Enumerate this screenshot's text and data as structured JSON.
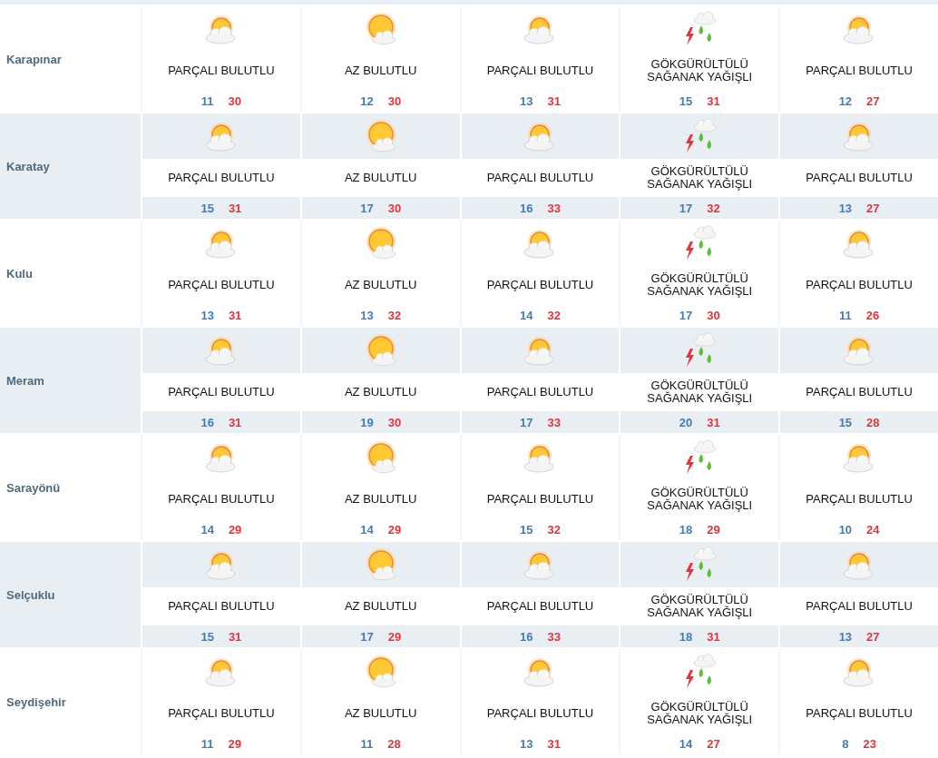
{
  "districts": [
    {
      "name": "Karapınar",
      "days": [
        {
          "kind": "partly-cloudy",
          "condition": "PARÇALI BULUTLU",
          "low": "11",
          "high": "30"
        },
        {
          "kind": "few-clouds",
          "condition": "AZ BULUTLU",
          "low": "12",
          "high": "30"
        },
        {
          "kind": "partly-cloudy",
          "condition": "PARÇALI BULUTLU",
          "low": "13",
          "high": "31"
        },
        {
          "kind": "thunderstorm",
          "condition": "GÖKGÜRÜLTÜLÜ SAĞANAK YAĞIŞLI",
          "low": "15",
          "high": "31"
        },
        {
          "kind": "partly-cloudy",
          "condition": "PARÇALI BULUTLU",
          "low": "12",
          "high": "27"
        }
      ]
    },
    {
      "name": "Karatay",
      "days": [
        {
          "kind": "partly-cloudy",
          "condition": "PARÇALI BULUTLU",
          "low": "15",
          "high": "31"
        },
        {
          "kind": "few-clouds",
          "condition": "AZ BULUTLU",
          "low": "17",
          "high": "30"
        },
        {
          "kind": "partly-cloudy",
          "condition": "PARÇALI BULUTLU",
          "low": "16",
          "high": "33"
        },
        {
          "kind": "thunderstorm",
          "condition": "GÖKGÜRÜLTÜLÜ SAĞANAK YAĞIŞLI",
          "low": "17",
          "high": "32"
        },
        {
          "kind": "partly-cloudy",
          "condition": "PARÇALI BULUTLU",
          "low": "13",
          "high": "27"
        }
      ]
    },
    {
      "name": "Kulu",
      "days": [
        {
          "kind": "partly-cloudy",
          "condition": "PARÇALI BULUTLU",
          "low": "13",
          "high": "31"
        },
        {
          "kind": "few-clouds",
          "condition": "AZ BULUTLU",
          "low": "13",
          "high": "32"
        },
        {
          "kind": "partly-cloudy",
          "condition": "PARÇALI BULUTLU",
          "low": "14",
          "high": "32"
        },
        {
          "kind": "thunderstorm",
          "condition": "GÖKGÜRÜLTÜLÜ SAĞANAK YAĞIŞLI",
          "low": "17",
          "high": "30"
        },
        {
          "kind": "partly-cloudy",
          "condition": "PARÇALI BULUTLU",
          "low": "11",
          "high": "26"
        }
      ]
    },
    {
      "name": "Meram",
      "days": [
        {
          "kind": "partly-cloudy",
          "condition": "PARÇALI BULUTLU",
          "low": "16",
          "high": "31"
        },
        {
          "kind": "few-clouds",
          "condition": "AZ BULUTLU",
          "low": "19",
          "high": "30"
        },
        {
          "kind": "partly-cloudy",
          "condition": "PARÇALI BULUTLU",
          "low": "17",
          "high": "33"
        },
        {
          "kind": "thunderstorm",
          "condition": "GÖKGÜRÜLTÜLÜ SAĞANAK YAĞIŞLI",
          "low": "20",
          "high": "31"
        },
        {
          "kind": "partly-cloudy",
          "condition": "PARÇALI BULUTLU",
          "low": "15",
          "high": "28"
        }
      ]
    },
    {
      "name": "Sarayönü",
      "days": [
        {
          "kind": "partly-cloudy",
          "condition": "PARÇALI BULUTLU",
          "low": "14",
          "high": "29"
        },
        {
          "kind": "few-clouds",
          "condition": "AZ BULUTLU",
          "low": "14",
          "high": "29"
        },
        {
          "kind": "partly-cloudy",
          "condition": "PARÇALI BULUTLU",
          "low": "15",
          "high": "32"
        },
        {
          "kind": "thunderstorm",
          "condition": "GÖKGÜRÜLTÜLÜ SAĞANAK YAĞIŞLI",
          "low": "18",
          "high": "29"
        },
        {
          "kind": "partly-cloudy",
          "condition": "PARÇALI BULUTLU",
          "low": "10",
          "high": "24"
        }
      ]
    },
    {
      "name": "Selçuklu",
      "days": [
        {
          "kind": "partly-cloudy",
          "condition": "PARÇALI BULUTLU",
          "low": "15",
          "high": "31"
        },
        {
          "kind": "few-clouds",
          "condition": "AZ BULUTLU",
          "low": "17",
          "high": "29"
        },
        {
          "kind": "partly-cloudy",
          "condition": "PARÇALI BULUTLU",
          "low": "16",
          "high": "33"
        },
        {
          "kind": "thunderstorm",
          "condition": "GÖKGÜRÜLTÜLÜ SAĞANAK YAĞIŞLI",
          "low": "18",
          "high": "31"
        },
        {
          "kind": "partly-cloudy",
          "condition": "PARÇALI BULUTLU",
          "low": "13",
          "high": "27"
        }
      ]
    },
    {
      "name": "Seydişehir",
      "days": [
        {
          "kind": "partly-cloudy",
          "condition": "PARÇALI BULUTLU",
          "low": "11",
          "high": "29"
        },
        {
          "kind": "few-clouds",
          "condition": "AZ BULUTLU",
          "low": "11",
          "high": "28"
        },
        {
          "kind": "partly-cloudy",
          "condition": "PARÇALI BULUTLU",
          "low": "13",
          "high": "31"
        },
        {
          "kind": "thunderstorm",
          "condition": "GÖKGÜRÜLTÜLÜ SAĞANAK YAĞIŞLI",
          "low": "14",
          "high": "27"
        },
        {
          "kind": "partly-cloudy",
          "condition": "PARÇALI BULUTLU",
          "low": "8",
          "high": "23"
        }
      ]
    }
  ]
}
